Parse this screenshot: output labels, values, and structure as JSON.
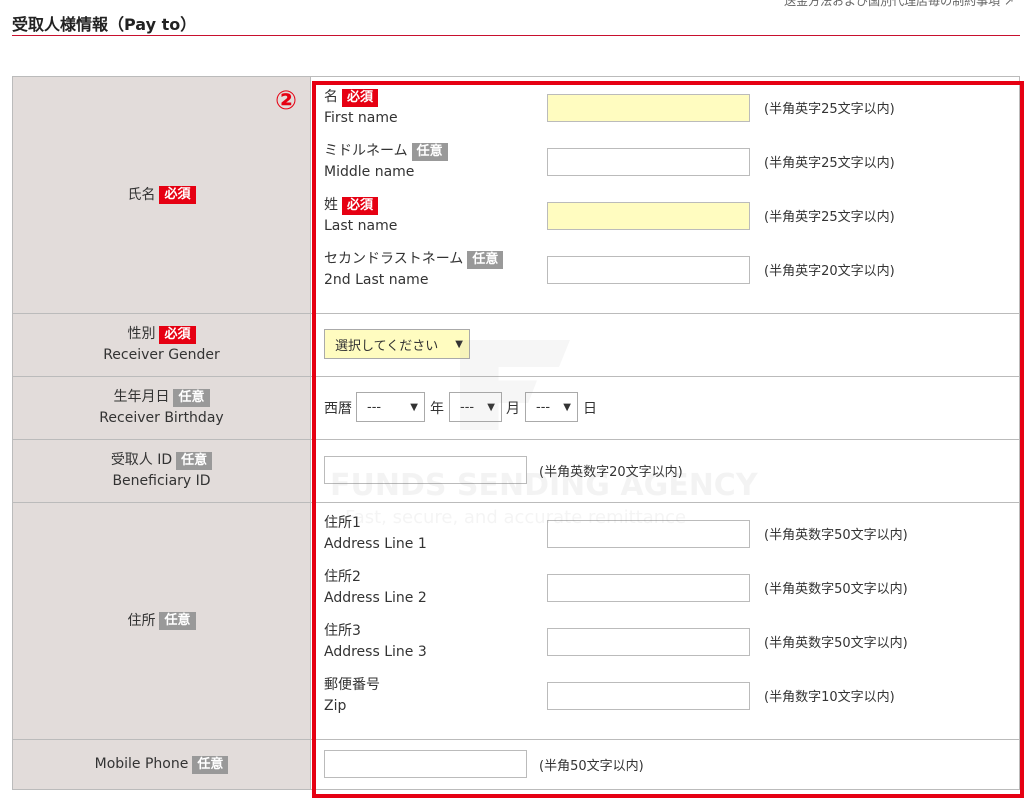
{
  "top_note": "送金方法および国別代理店毎の制約事項",
  "section_title": "受取人様情報（Pay to）",
  "step_marker": "②",
  "badges": {
    "required": "必須",
    "optional": "任意"
  },
  "name": {
    "label": "氏名",
    "first": {
      "jp": "名",
      "en": "First name",
      "hint": "(半角英字25文字以内)"
    },
    "middle": {
      "jp": "ミドルネーム",
      "en": "Middle name",
      "hint": "(半角英字25文字以内)"
    },
    "last": {
      "jp": "姓",
      "en": "Last name",
      "hint": "(半角英字25文字以内)"
    },
    "second_last": {
      "jp": "セカンドラストネーム",
      "en": "2nd Last name",
      "hint": "(半角英字20文字以内)"
    }
  },
  "gender": {
    "jp": "性別",
    "en": "Receiver Gender",
    "select_value": "選択してください"
  },
  "birthday": {
    "jp": "生年月日",
    "en": "Receiver Birthday",
    "era": "西暦",
    "year_select": "---",
    "year_unit": "年",
    "month_select": "---",
    "month_unit": "月",
    "day_select": "---",
    "day_unit": "日"
  },
  "beneficiary": {
    "jp": "受取人 ID",
    "en": "Beneficiary ID",
    "hint": "(半角英数字20文字以内)"
  },
  "address": {
    "label": "住所",
    "line1": {
      "jp": "住所1",
      "en": "Address Line 1",
      "hint": "(半角英数字50文字以内)"
    },
    "line2": {
      "jp": "住所2",
      "en": "Address Line 2",
      "hint": "(半角英数字50文字以内)"
    },
    "line3": {
      "jp": "住所3",
      "en": "Address Line 3",
      "hint": "(半角英数字50文字以内)"
    },
    "zip": {
      "jp": "郵便番号",
      "en": "Zip",
      "hint": "(半角数字10文字以内)"
    }
  },
  "mobile": {
    "label": "Mobile Phone",
    "hint": "(半角50文字以内)"
  },
  "watermark": {
    "title": "FUNDS SENDING AGENCY",
    "subtitle": "Fast, secure, and accurate remittance"
  },
  "colors": {
    "accent_red": "#e60012",
    "label_bg": "#e2dcda",
    "highlight_input": "#fffcc0",
    "optional_badge": "#999999"
  }
}
